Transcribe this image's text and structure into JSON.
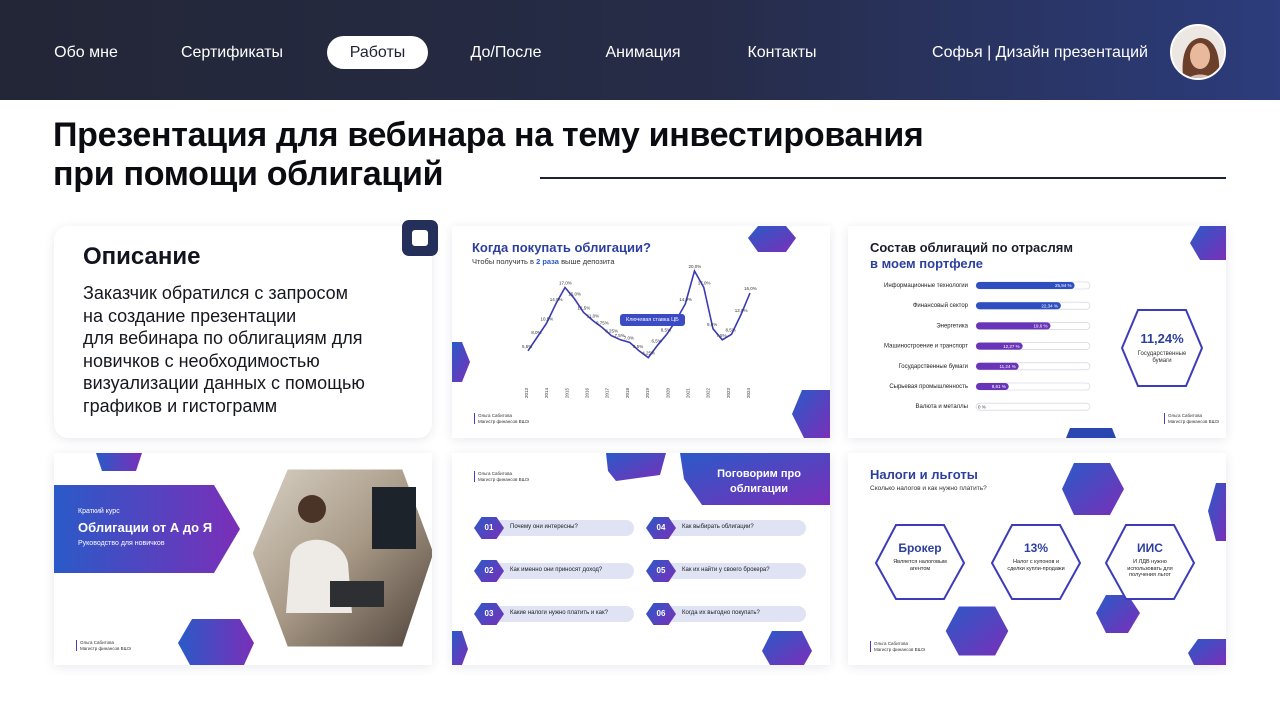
{
  "nav": {
    "items": [
      "Обо мне",
      "Сертификаты",
      "Работы",
      "До/После",
      "Анимация",
      "Контакты"
    ],
    "active": "Работы",
    "brand": "Софья | Дизайн презентаций"
  },
  "title": {
    "line1": "Презентация для вебинара на тему инвестирования",
    "line2": "при помощи облигаций"
  },
  "description": {
    "heading": "Описание",
    "text": "Заказчик обратился с запросом\nна создание презентации\nдля вебинара по облигациям для\nновичков с необходимостью\nвизуализации данных с помощью\nграфиков и гистограмм"
  },
  "colors": {
    "header_dark": "#232636",
    "header_blue": "#2c3c7c",
    "accent_blue": "#2a5ac8",
    "accent_purple": "#7a2fb8"
  },
  "author": {
    "name": "Ольга Сабитова",
    "role": "Магистр финансов ВШЭ"
  },
  "slide_chart": {
    "title": "Когда покупать облигации?",
    "subtitle_prefix": "Чтобы получить в ",
    "subtitle_highlight": "2 раза",
    "subtitle_suffix": " выше депозита",
    "legend": "Ключевая ставка ЦБ",
    "chart_data": {
      "type": "line",
      "title": "Когда покупать облигации?",
      "x": [
        "2013",
        "2014",
        "2015",
        "2016",
        "2017",
        "2018",
        "2019",
        "2020",
        "2021",
        "2022",
        "2023",
        "2024"
      ],
      "series": [
        {
          "name": "Ключевая ставка ЦБ",
          "labels": [
            "5,5%",
            "8,0%",
            "10,5%",
            "14,0%",
            "17,0%",
            "15,0%",
            "12,5%",
            "11,0%",
            "9,75%",
            "8,25%",
            "7,5%",
            "7,0%",
            "5,5%",
            "4,25%",
            "6,5%",
            "8,5%",
            "11,0%",
            "14,0%",
            "20,0%",
            "17,0%",
            "9,5%",
            "7,5%",
            "8,5%",
            "12,0%",
            "16,0%"
          ],
          "values": [
            5.5,
            8.0,
            10.5,
            14.0,
            17.0,
            15.0,
            12.5,
            11.0,
            9.75,
            8.25,
            7.5,
            7.0,
            5.5,
            4.25,
            6.5,
            8.5,
            11.0,
            14.0,
            20.0,
            17.0,
            9.5,
            7.5,
            8.5,
            12.0,
            16.0
          ]
        }
      ]
    }
  },
  "slide_bars": {
    "title1": "Состав облигаций по отраслям",
    "title2": "в моем портфеле",
    "badge_value": "11,24%",
    "badge_label1": "Государственные",
    "badge_label2": "бумаги",
    "chart_data": {
      "type": "bar",
      "categories": [
        "Информационные технологии",
        "Финансовый сектор",
        "Энергетика",
        "Машиностроение и транспорт",
        "Государственные бумаги",
        "Сырьевая промышленность",
        "Валюта и металлы"
      ],
      "values": [
        25.94,
        22.34,
        19.6,
        12.27,
        11.24,
        8.61,
        0
      ],
      "labels": [
        "25,94 %",
        "22,34 %",
        "19,6 %",
        "12,27 %",
        "11,24 %",
        "8,61 %",
        "0 %"
      ]
    }
  },
  "slide_cover": {
    "kicker": "Краткий курс",
    "title": "Облигации от А до Я",
    "subtitle": "Руководство для новичков"
  },
  "slide_topics": {
    "heading1": "Поговорим про",
    "heading2": "облигации",
    "items": [
      {
        "num": "01",
        "text": "Почему они интересны?"
      },
      {
        "num": "02",
        "text": "Как именно они приносят доход?"
      },
      {
        "num": "03",
        "text": "Какие налоги нужно платить и как?"
      },
      {
        "num": "04",
        "text": "Как выбирать облигации?"
      },
      {
        "num": "05",
        "text": "Как их найти у своего брокера?"
      },
      {
        "num": "06",
        "text": "Когда их выгодно покупать?"
      }
    ]
  },
  "slide_taxes": {
    "title": "Налоги и льготы",
    "subtitle": "Сколько налогов и как нужно платить?",
    "cards": [
      {
        "head": "Брокер",
        "body": "Является налоговым агентом"
      },
      {
        "head": "13%",
        "body": "Налог с купонов и сделки купли-продажи"
      },
      {
        "head": "ИИС",
        "body": "И ЛДВ нужно использовать для получения льгот"
      }
    ]
  }
}
